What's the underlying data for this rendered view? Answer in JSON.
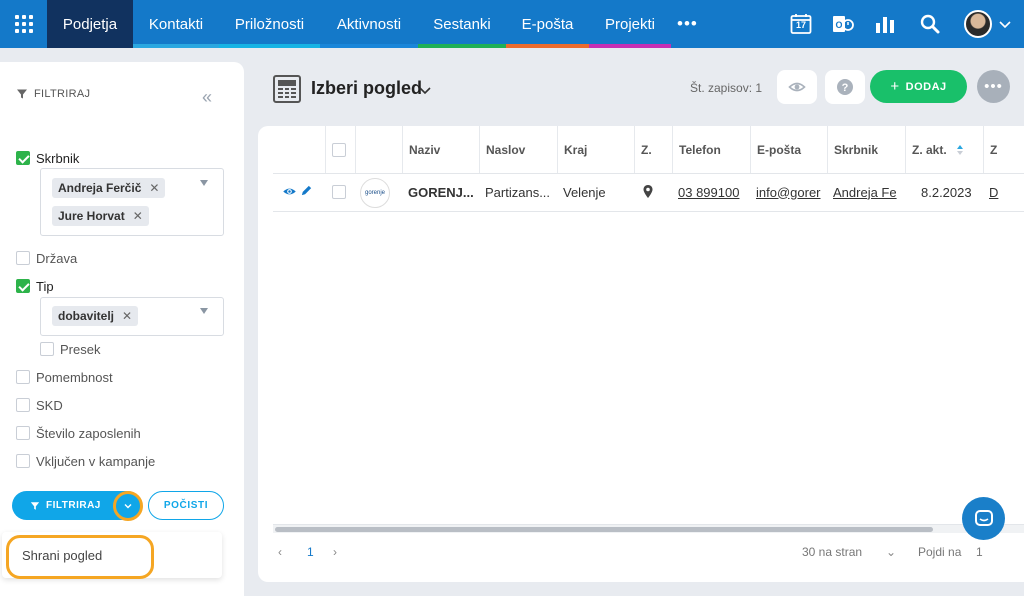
{
  "nav": {
    "tabs": [
      {
        "label": "Podjetja",
        "color": ""
      },
      {
        "label": "Kontakti",
        "color": "#2aa7e0"
      },
      {
        "label": "Priložnosti",
        "color": "#16b3e4"
      },
      {
        "label": "Aktivnosti",
        "color": "#1a86d9"
      },
      {
        "label": "Sestanki",
        "color": "#1fb057"
      },
      {
        "label": "E-pošta",
        "color": "#ec6b2d"
      },
      {
        "label": "Projekti",
        "color": "#c52fb4"
      }
    ],
    "more": "•••",
    "calendar_day": "17",
    "icons": [
      "apps-grid-icon",
      "calendar-icon",
      "outlook-sync-icon",
      "bar-chart-icon",
      "search-icon",
      "avatar",
      "chevron-down-icon"
    ]
  },
  "filter": {
    "title": "FILTRIRAJ",
    "skrbnik": {
      "label": "Skrbnik",
      "checked": true,
      "chips": [
        "Andreja Ferčič",
        "Jure Horvat"
      ]
    },
    "drzava": {
      "label": "Država",
      "checked": false
    },
    "tip": {
      "label": "Tip",
      "checked": true,
      "chips": [
        "dobavitelj"
      ],
      "presek": "Presek"
    },
    "pomembnost": {
      "label": "Pomembnost",
      "checked": false
    },
    "skd": {
      "label": "SKD",
      "checked": false
    },
    "zaposleni": {
      "label": "Število zaposlenih",
      "checked": false
    },
    "kampanje": {
      "label": "Vključen v kampanje",
      "checked": false
    },
    "filter_button": "FILTRIRAJ",
    "clear_button": "POČISTI",
    "save_view": "Shrani pogled"
  },
  "header": {
    "view_title": "Izberi pogled",
    "record_count": "Št. zapisov: 1",
    "add_button": "DODAJ",
    "add_plus": "+",
    "dots": "•••"
  },
  "table": {
    "columns": [
      "Naziv",
      "Naslov",
      "Kraj",
      "Z.",
      "Telefon",
      "E-pošta",
      "Skrbnik",
      "Z. akt.",
      "Z"
    ],
    "row": {
      "logo_text": "gorenje",
      "naziv": "GORENJ...",
      "naslov": "Partizans...",
      "kraj": "Velenje",
      "telefon": "03 899100",
      "eposta": "info@gorer",
      "skrbnik": "Andreja Fe",
      "z_akt": "8.2.2023",
      "z": "D"
    }
  },
  "pager": {
    "page": "1",
    "per_page": "30 na stran",
    "goto": "Pojdi na",
    "goto_value": "1"
  }
}
